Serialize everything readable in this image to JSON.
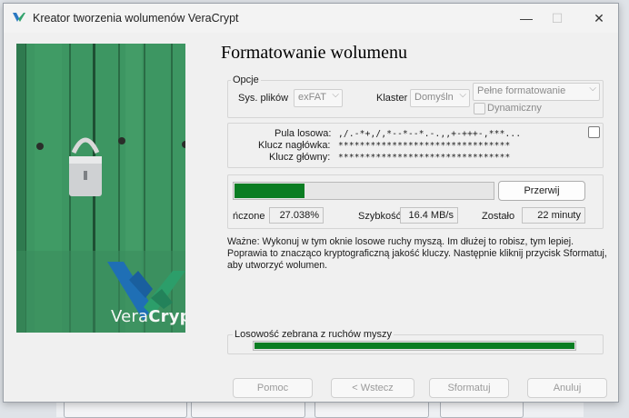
{
  "window": {
    "title": "Kreator tworzenia wolumenów VeraCrypt",
    "minimize_glyph": "—",
    "maximize_glyph": "☐",
    "close_glyph": "✕"
  },
  "brand": {
    "part1": "Vera",
    "part2": "Crypt"
  },
  "page_title": "Formatowanie wolumenu",
  "options": {
    "legend": "Opcje",
    "fs_label": "Sys. plików",
    "fs_value": "exFAT",
    "cluster_label": "Klaster",
    "cluster_value": "Domyśln",
    "format_mode_value": "Pełne formatowanie",
    "dynamic_label": "Dynamiczny",
    "dynamic_checked": false
  },
  "keys": {
    "pool_label": "Pula losowa:",
    "pool_value": ",/.-*+,/,*--*--*.-.,,+-+++-,***...",
    "header_key_label": "Klucz nagłówka:",
    "header_key_value": "********************************",
    "master_key_label": "Klucz główny:",
    "master_key_value": "********************************",
    "show_checked": false
  },
  "progress": {
    "fraction": 0.27038,
    "abort_label": "Przerwij",
    "done_label": "ńczone",
    "done_value": "27.038%",
    "speed_label": "Szybkość",
    "speed_value": "16.4 MB/s",
    "left_label": "Zostało",
    "left_value": "22 minuty"
  },
  "notice": "Ważne: Wykonuj w tym oknie losowe ruchy myszą. Im dłużej to robisz, tym lepiej. Poprawia to znacząco kryptograficzną jakość kluczy. Następnie kliknij przycisk Sformatuj, aby utworzyć wolumen.",
  "entropy": {
    "label": "Losowość zebrana z ruchów myszy",
    "fraction": 1.0
  },
  "buttons": {
    "help": "Pomoc",
    "back": "< Wstecz",
    "format": "Sformatuj",
    "cancel": "Anuluj"
  },
  "colors": {
    "progress_fill": "#0a7d22",
    "entropy_fill": "#0a7d22",
    "logo_blue": "#1f6fb5",
    "logo_green": "#2c9e6a"
  }
}
